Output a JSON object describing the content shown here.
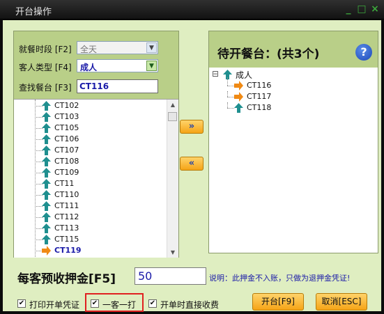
{
  "window": {
    "title": "开台操作",
    "buttons": [
      "_",
      "□",
      "×"
    ]
  },
  "filters": {
    "period_label": "就餐时段 [F2]",
    "period_value": "全天",
    "guest_type_label": "客人类型 [F4]",
    "guest_type_value": "成人",
    "search_label": "查找餐台 [F3]",
    "search_value": "CT116"
  },
  "available_tables": {
    "items": [
      {
        "name": "CT102",
        "icon": "up-arrow-icon"
      },
      {
        "name": "CT103",
        "icon": "up-arrow-icon"
      },
      {
        "name": "CT105",
        "icon": "up-arrow-icon"
      },
      {
        "name": "CT106",
        "icon": "up-arrow-icon"
      },
      {
        "name": "CT107",
        "icon": "up-arrow-icon"
      },
      {
        "name": "CT108",
        "icon": "up-arrow-icon"
      },
      {
        "name": "CT109",
        "icon": "up-arrow-icon"
      },
      {
        "name": "CT11",
        "icon": "up-arrow-icon"
      },
      {
        "name": "CT110",
        "icon": "up-arrow-icon"
      },
      {
        "name": "CT111",
        "icon": "up-arrow-icon"
      },
      {
        "name": "CT112",
        "icon": "up-arrow-icon"
      },
      {
        "name": "CT113",
        "icon": "up-arrow-icon"
      },
      {
        "name": "CT115",
        "icon": "up-arrow-icon"
      },
      {
        "name": "CT119",
        "icon": "right-arrow-icon",
        "selected": true
      }
    ]
  },
  "move_buttons": {
    "add": "»",
    "remove": "«"
  },
  "pending": {
    "title": "待开餐台：(共3个)",
    "help": "?",
    "root": "成人",
    "tree_toggle": "⊟",
    "items": [
      {
        "name": "CT116",
        "icon": "right-arrow-icon"
      },
      {
        "name": "CT117",
        "icon": "right-arrow-icon"
      },
      {
        "name": "CT118",
        "icon": "up-arrow-icon"
      }
    ]
  },
  "deposit": {
    "label": "每客预收押金[F5]",
    "value": "50",
    "note": "说明：此押金不入账，只做为退押金凭证!"
  },
  "options": [
    {
      "label": "打印开单凭证",
      "checked": true
    },
    {
      "label": "一客一打",
      "checked": true
    },
    {
      "label": "开单时直接收费",
      "checked": true
    }
  ],
  "actions": {
    "open": "开台[F9]",
    "cancel": "取消[ESC]"
  },
  "colors": {
    "panel_green": "#b9cf88",
    "client_bg": "#dfeec1",
    "arrow_green": "#1f8f8f",
    "arrow_orange": "#f08a14",
    "selected_blue": "#1a1aa8",
    "highlight_red": "#e02020"
  }
}
